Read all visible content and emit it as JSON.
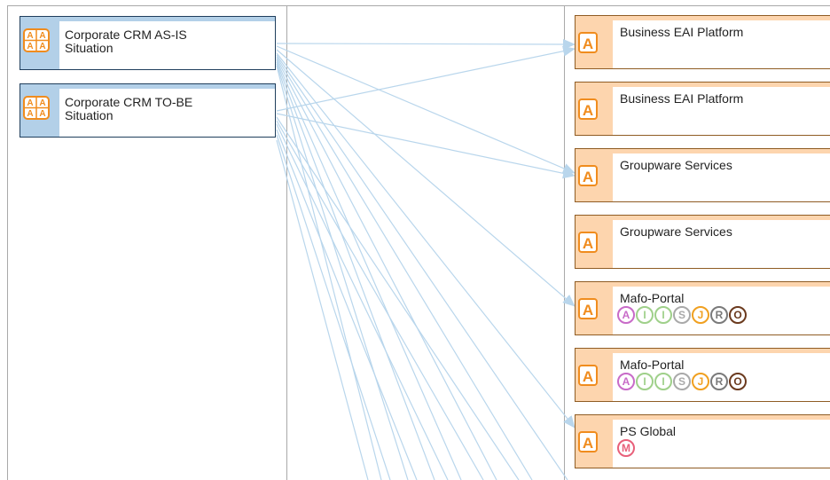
{
  "sources": [
    {
      "name": "Corporate CRM AS-IS\nSituation",
      "icon": "application-group-icon"
    },
    {
      "name": "Corporate CRM TO-BE\nSituation",
      "icon": "application-group-icon"
    }
  ],
  "targets": [
    {
      "name": "Business EAI Platform",
      "icon": "application-icon",
      "badges": []
    },
    {
      "name": "Business EAI Platform",
      "icon": "application-icon",
      "badges": []
    },
    {
      "name": "Groupware Services",
      "icon": "application-icon",
      "badges": []
    },
    {
      "name": "Groupware Services",
      "icon": "application-icon",
      "badges": []
    },
    {
      "name": "Mafo-Portal",
      "icon": "application-icon",
      "badges": [
        {
          "letter": "A",
          "color": "#c86bc8"
        },
        {
          "letter": "I",
          "color": "#9fd08a"
        },
        {
          "letter": "I",
          "color": "#9fd08a"
        },
        {
          "letter": "S",
          "color": "#a9a9a9"
        },
        {
          "letter": "J",
          "color": "#f0a020"
        },
        {
          "letter": "R",
          "color": "#7a7a7a"
        },
        {
          "letter": "O",
          "color": "#6b3a1e"
        }
      ]
    },
    {
      "name": "Mafo-Portal",
      "icon": "application-icon",
      "badges": [
        {
          "letter": "A",
          "color": "#c86bc8"
        },
        {
          "letter": "I",
          "color": "#9fd08a"
        },
        {
          "letter": "I",
          "color": "#9fd08a"
        },
        {
          "letter": "S",
          "color": "#a9a9a9"
        },
        {
          "letter": "J",
          "color": "#f0a020"
        },
        {
          "letter": "R",
          "color": "#7a7a7a"
        },
        {
          "letter": "O",
          "color": "#6b3a1e"
        }
      ]
    },
    {
      "name": "PS Global",
      "icon": "application-icon",
      "badges": [
        {
          "letter": "M",
          "color": "#e8607a"
        }
      ]
    }
  ],
  "colors": {
    "source_accent": "#b3d0e8",
    "source_border": "#1f3e5c",
    "target_accent": "#fdd5ae",
    "target_border": "#8f5c24",
    "icon_orange": "#f08c1e",
    "connector": "#b9d6ec"
  }
}
